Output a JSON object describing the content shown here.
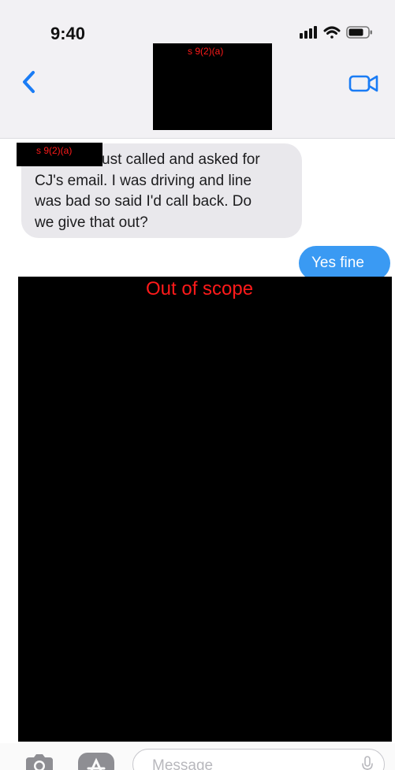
{
  "status_bar": {
    "time": "9:40",
    "icons": [
      "signal-bars-icon",
      "wifi-icon",
      "battery-icon"
    ]
  },
  "header": {
    "back_icon": "chevron-left-icon",
    "video_icon": "video-camera-icon",
    "contact_redaction_label": "s 9(2)(a)"
  },
  "messages": {
    "incoming": {
      "redaction_label": "s 9(2)(a)",
      "lines": [
        "ust called and asked for",
        "CJ's email. I was driving and line",
        "was bad so said I'd call back. Do",
        "we give that out?"
      ]
    },
    "outgoing": {
      "text": "Yes fine"
    },
    "out_of_scope_label": "Out of scope"
  },
  "composer": {
    "placeholder": "Message",
    "icons": [
      "camera-icon",
      "app-store-icon",
      "microphone-icon"
    ]
  },
  "colors": {
    "outgoing_bubble": "#3a9af3",
    "incoming_bubble": "#e9e8ec",
    "accent": "#1a7cf5",
    "redaction_text": "#ff1a1a"
  }
}
